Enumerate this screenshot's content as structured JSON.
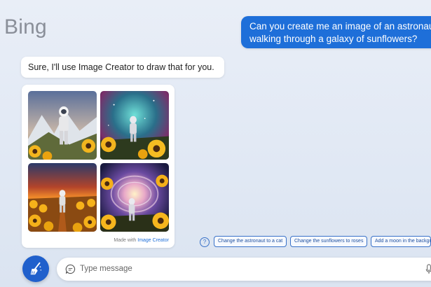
{
  "app": {
    "brand": "Bing"
  },
  "conversation": {
    "user_message_lines": [
      "Can you create me an image of an astronaut",
      "walking through a galaxy of sunflowers?"
    ],
    "bot_reply": "Sure, I'll use Image Creator to draw that for you.",
    "image_card": {
      "footer_prefix": "Made with",
      "footer_link": "Image Creator",
      "images": [
        "astronaut-mountains-sunflowers",
        "astronaut-nebula-sunflowers",
        "astronaut-sunflower-field-sunset",
        "astronaut-galaxy-swirl-sunflowers"
      ]
    }
  },
  "suggestions": {
    "help_icon": "question-circle-icon",
    "chips": [
      "Change the astronaut to a cat",
      "Change the sunflowers to roses",
      "Add a moon in the background"
    ]
  },
  "composer": {
    "new_topic_icon": "broom-icon",
    "placeholder": "Type message",
    "chat_icon": "chat-bubble-icon",
    "mic_icon": "microphone-icon"
  },
  "colors": {
    "accent": "#1e6fd9",
    "chip_border": "#3a72c8",
    "new_topic_bg": "#2060cc"
  }
}
